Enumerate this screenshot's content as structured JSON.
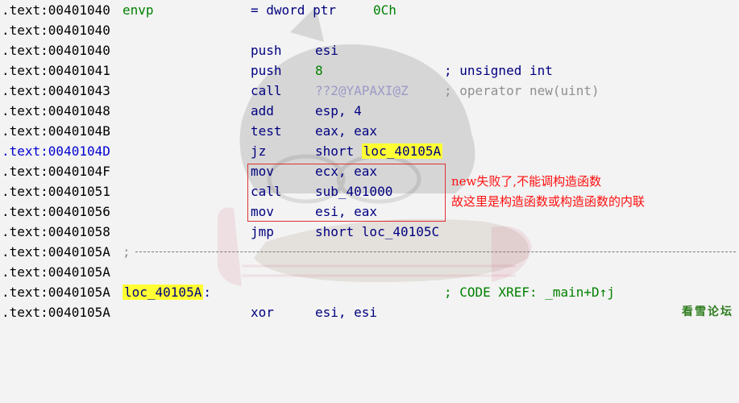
{
  "listing": {
    "rows": [
      {
        "addr": ".text:00401040",
        "label": "envp",
        "mnemonic": "= dword ptr",
        "operand": "0Ch"
      },
      {
        "addr": ".text:00401040"
      },
      {
        "addr": ".text:00401040",
        "mnemonic": "push",
        "operand": "esi"
      },
      {
        "addr": ".text:00401041",
        "mnemonic": "push",
        "operand": "8",
        "comment": "; unsigned int"
      },
      {
        "addr": ".text:00401043",
        "mnemonic": "call",
        "operand": "??2@YAPAXI@Z",
        "comment": "; operator new(uint)"
      },
      {
        "addr": ".text:00401048",
        "mnemonic": "add",
        "operand": "esp, 4"
      },
      {
        "addr": ".text:0040104B",
        "mnemonic": "test",
        "operand": "eax, eax"
      },
      {
        "addr": ".text:0040104D",
        "mnemonic": "jz",
        "operand_pre": "short ",
        "operand_hl": "loc_40105A"
      },
      {
        "addr": ".text:0040104F",
        "mnemonic": "mov",
        "operand": "ecx, eax"
      },
      {
        "addr": ".text:00401051",
        "mnemonic": "call",
        "operand": "sub_401000"
      },
      {
        "addr": ".text:00401056",
        "mnemonic": "mov",
        "operand": "esi, eax"
      },
      {
        "addr": ".text:00401058",
        "mnemonic": "jmp",
        "operand": "short loc_40105C"
      },
      {
        "addr": ".text:0040105A",
        "separator": ";"
      },
      {
        "addr": ".text:0040105A"
      },
      {
        "addr": ".text:0040105A",
        "label": "loc_40105A",
        "label_suffix": ":",
        "comment": "; CODE XREF: _main+D↑j"
      },
      {
        "addr": ".text:0040105A",
        "mnemonic": "xor",
        "operand": "esi, esi"
      }
    ]
  },
  "annotation": {
    "line1": "new失败了,不能调构造函数",
    "line2": "故这里是构造函数或构造函数的内联"
  },
  "watermark": "看雪论坛",
  "colors": {
    "code": "#000080",
    "address": "#000000",
    "address_highlight": "#0000d0",
    "number": "#008000",
    "highlight": "#ffff33",
    "annotation": "#ff1010",
    "box": "#e03030"
  }
}
